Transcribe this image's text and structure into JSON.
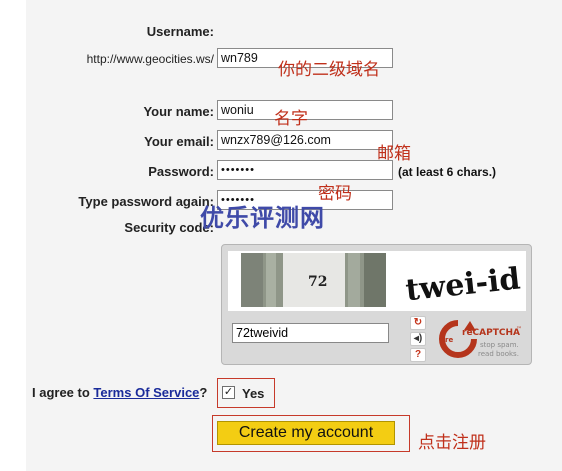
{
  "form": {
    "username_label": "Username:",
    "url_prefix": "http://www.geocities.ws/",
    "username_value": "wn789",
    "name_label": "Your name:",
    "name_value": "woniu",
    "email_label": "Your email:",
    "email_value": "wnzx789@126.com",
    "password_label": "Password:",
    "password_mask": "•••••••",
    "password_hint": "(at least 6 chars.)",
    "confirm_label": "Type password again:",
    "confirm_mask": "•••••••",
    "security_label": "Security code:"
  },
  "captcha": {
    "challenge_word_1": "72",
    "challenge_word_2": "twei-id",
    "response_value": "72tweivid",
    "logo_main": "reCAPTCHA",
    "logo_tm": "™",
    "logo_tag_1": "stop spam.",
    "logo_tag_2": "read books.",
    "reload_icon": "reload-icon",
    "audio_icon": "audio-icon",
    "help_icon": "help-icon"
  },
  "agreement": {
    "prefix": "I agree to",
    "tos_link": "Terms Of Service",
    "suffix": "?",
    "yes_label": "Yes",
    "checked": true
  },
  "submit": {
    "label": "Create my account"
  },
  "annotations": {
    "subdomain": "你的二级域名",
    "name": "名字",
    "email": "邮箱",
    "password": "密码",
    "submit": "点击注册"
  },
  "watermark": "优乐评测网",
  "colors": {
    "annotation": "#c0301b",
    "button": "#f3cd13",
    "link": "#1a2b9a",
    "watermark": "#3f4aa8"
  }
}
